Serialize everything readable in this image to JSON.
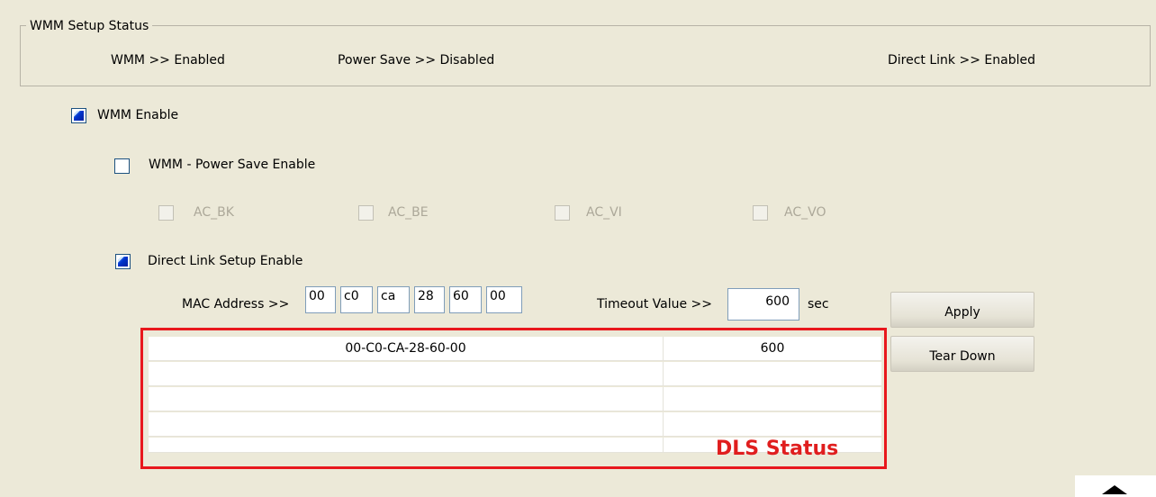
{
  "group": {
    "legend": "WMM Setup Status",
    "wmm_status": "WMM >> Enabled",
    "power_save_status": "Power Save >> Disabled",
    "direct_link_status": "Direct Link >> Enabled"
  },
  "checkboxes": {
    "wmm_enable": {
      "label": "WMM Enable",
      "checked": true
    },
    "power_save_enable": {
      "label": "WMM - Power Save Enable",
      "checked": false
    },
    "ac_bk": {
      "label": "AC_BK",
      "checked": false,
      "disabled": true
    },
    "ac_be": {
      "label": "AC_BE",
      "checked": false,
      "disabled": true
    },
    "ac_vi": {
      "label": "AC_VI",
      "checked": false,
      "disabled": true
    },
    "ac_vo": {
      "label": "AC_VO",
      "checked": false,
      "disabled": true
    },
    "dls_enable": {
      "label": "Direct Link Setup Enable",
      "checked": true
    }
  },
  "dls": {
    "mac_label": "MAC Address >>",
    "mac": [
      "00",
      "c0",
      "ca",
      "28",
      "60",
      "00"
    ],
    "timeout_label": "Timeout Value >>",
    "timeout_value": "600",
    "timeout_unit": "sec",
    "apply_label": "Apply",
    "teardown_label": "Tear Down"
  },
  "table": {
    "rows": [
      {
        "mac": "00-C0-CA-28-60-00",
        "timeout": "600"
      },
      {
        "mac": "",
        "timeout": ""
      },
      {
        "mac": "",
        "timeout": ""
      },
      {
        "mac": "",
        "timeout": ""
      },
      {
        "mac": "",
        "timeout": ""
      }
    ]
  },
  "annotation": {
    "label": "DLS Status",
    "color": "#E01E1E"
  },
  "icons": {
    "scroll": "triangle-up-icon"
  }
}
